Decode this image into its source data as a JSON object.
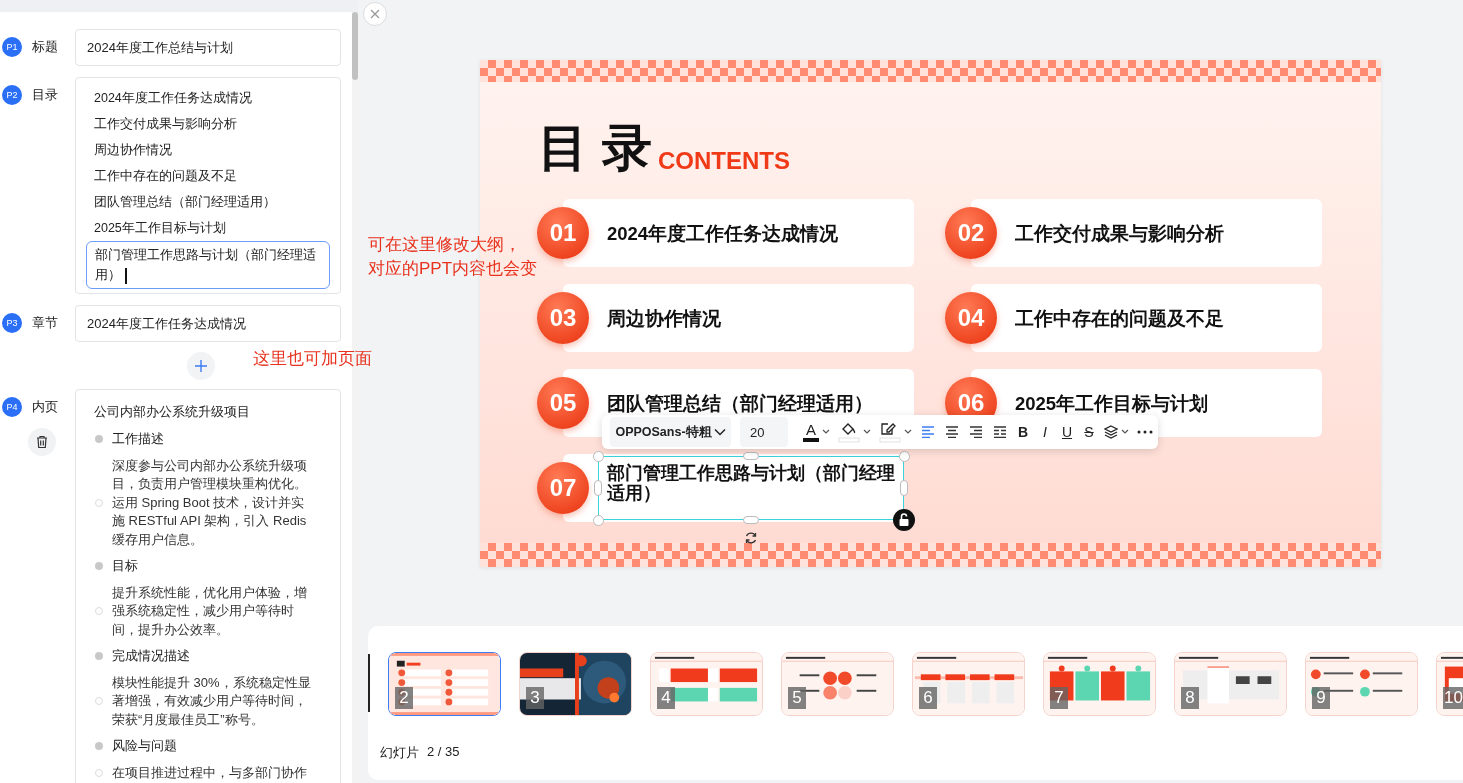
{
  "outline": {
    "sections": [
      {
        "kind": "field",
        "badge": "P1",
        "label": "标题",
        "value": "2024年度工作总结与计划"
      },
      {
        "kind": "list",
        "badge": "P2",
        "label": "目录",
        "items": [
          {
            "text": "2024年度工作任务达成情况",
            "focused": false
          },
          {
            "text": "工作交付成果与影响分析",
            "focused": false
          },
          {
            "text": "周边协作情况",
            "focused": false
          },
          {
            "text": "工作中存在的问题及不足",
            "focused": false
          },
          {
            "text": "团队管理总结（部门经理适用）",
            "focused": false
          },
          {
            "text": "2025年工作目标与计划",
            "focused": false
          },
          {
            "text": "部门管理工作思路与计划（部门经理适用）",
            "focused": true
          }
        ]
      },
      {
        "kind": "field",
        "badge": "P3",
        "label": "章节",
        "value": "2024年度工作任务达成情况"
      },
      {
        "kind": "add"
      },
      {
        "kind": "content",
        "badge": "P4",
        "label": "内页",
        "title": "公司内部办公系统升级项目",
        "blocks": [
          {
            "kind": "heading",
            "text": "工作描述"
          },
          {
            "kind": "body",
            "text": "深度参与公司内部办公系统升级项目，负责用户管理模块重构优化。运用 Spring Boot 技术，设计并实施 RESTful API 架构，引入 Redis 缓存用户信息。"
          },
          {
            "kind": "heading",
            "text": "目标"
          },
          {
            "kind": "body",
            "text": "提升系统性能，优化用户体验，增强系统稳定性，减少用户等待时间，提升办公效率。"
          },
          {
            "kind": "heading",
            "text": "完成情况描述"
          },
          {
            "kind": "body",
            "text": "模块性能提升 30%，系统稳定性显著增强，有效减少用户等待时间，荣获“月度最佳员工”称号。"
          },
          {
            "kind": "heading",
            "text": "风险与问题"
          },
          {
            "kind": "body",
            "text": "在项目推进过程中，与多部门协作"
          }
        ]
      }
    ]
  },
  "annotations": [
    {
      "kind": "outline",
      "lines": [
        "可在这里修改大纲，",
        "对应的PPT内容也会变"
      ]
    },
    {
      "kind": "add",
      "lines": [
        "这里也可加页面"
      ]
    }
  ],
  "slide": {
    "title": "目 录",
    "subtitle": "CONTENTS",
    "items": [
      {
        "number": "01",
        "text": "2024年度工作任务达成情况",
        "selected": false
      },
      {
        "number": "02",
        "text": "工作交付成果与影响分析",
        "selected": false
      },
      {
        "number": "03",
        "text": "周边协作情况",
        "selected": false
      },
      {
        "number": "04",
        "text": "工作中存在的问题及不足",
        "selected": false
      },
      {
        "number": "05",
        "text": "团队管理总结（部门经理适用）",
        "selected": false
      },
      {
        "number": "06",
        "text": "2025年工作目标与计划",
        "selected": false
      },
      {
        "number": "07",
        "text": "部门管理工作思路与计划（部门经理适用）",
        "selected": true
      }
    ]
  },
  "toolbar": {
    "font": "OPPOSans-特粗",
    "size": "20",
    "text_color_glyph": "A",
    "alignments": [
      {
        "kind": "left",
        "selected": true
      },
      {
        "kind": "center",
        "selected": false
      },
      {
        "kind": "right",
        "selected": false
      },
      {
        "kind": "justify",
        "selected": false
      }
    ],
    "formats": [
      {
        "kind": "bold",
        "glyph": "B"
      },
      {
        "kind": "italic",
        "glyph": "I"
      },
      {
        "kind": "underline",
        "glyph": "U"
      },
      {
        "kind": "strike",
        "glyph": "S"
      }
    ]
  },
  "thumbnails": [
    {
      "number": "2",
      "kind": "contents",
      "selected": true
    },
    {
      "number": "3",
      "kind": "cover",
      "selected": false
    },
    {
      "number": "4",
      "kind": "cards",
      "selected": false
    },
    {
      "number": "5",
      "kind": "circles",
      "selected": false
    },
    {
      "number": "6",
      "kind": "steps",
      "selected": false
    },
    {
      "number": "7",
      "kind": "columns",
      "selected": false
    },
    {
      "number": "8",
      "kind": "tabs",
      "selected": false
    },
    {
      "number": "9",
      "kind": "pins",
      "selected": false
    },
    {
      "number": "10",
      "kind": "banner",
      "selected": false
    }
  ],
  "slide_counter": {
    "label": "幻灯片",
    "value": "2 / 35"
  }
}
